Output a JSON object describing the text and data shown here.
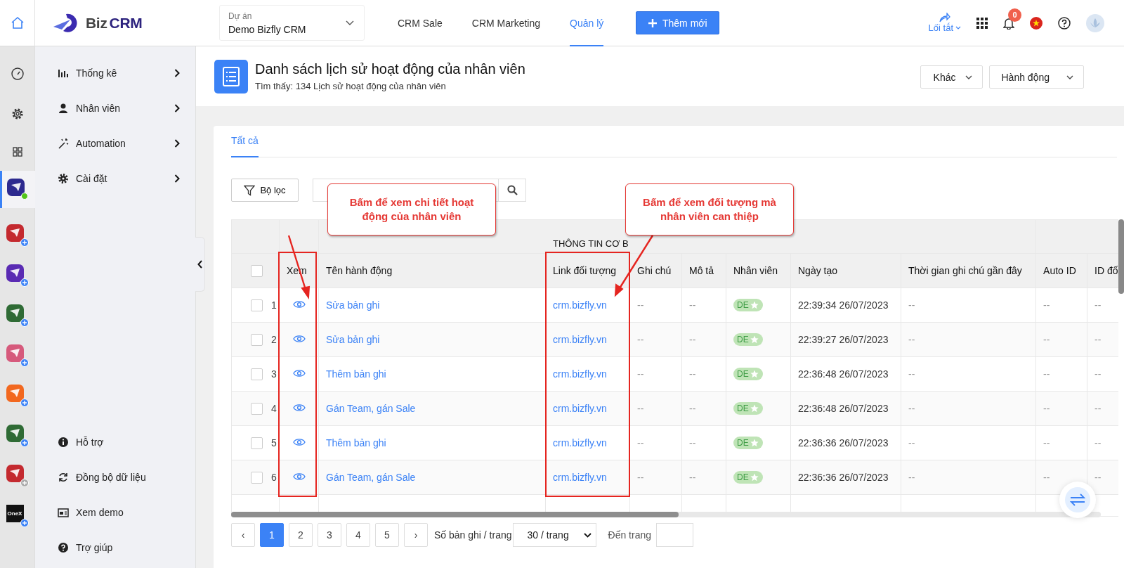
{
  "topbar": {
    "logo": {
      "light": "Biz",
      "bold": "CRM"
    },
    "project": {
      "label": "Dự án",
      "value": "Demo Bizfly CRM"
    },
    "nav": [
      {
        "label": "CRM Sale",
        "selected": false
      },
      {
        "label": "CRM Marketing",
        "selected": false
      },
      {
        "label": "Quản lý",
        "selected": true
      }
    ],
    "add_button": "Thêm mới",
    "shortcut": "Lối tắt",
    "notification_count": "0"
  },
  "rail": [
    {
      "kind": "dashboard",
      "selected": false
    },
    {
      "kind": "settings",
      "selected": false
    },
    {
      "kind": "grid",
      "selected": false
    },
    {
      "kind": "app",
      "color": "#2d2a8f",
      "online": true,
      "plus": false,
      "selected": true
    },
    {
      "kind": "app",
      "color": "#c42a2f",
      "online": false,
      "plus": true,
      "muted": false,
      "selected": false
    },
    {
      "kind": "app",
      "color": "#5a2bb3",
      "online": false,
      "plus": true,
      "muted": false,
      "selected": false
    },
    {
      "kind": "app",
      "color": "#2f6b35",
      "online": false,
      "plus": true,
      "muted": false,
      "selected": false
    },
    {
      "kind": "app",
      "color": "#d65a7c",
      "online": false,
      "plus": true,
      "muted": false,
      "selected": false
    },
    {
      "kind": "app",
      "color": "#f2681f",
      "online": false,
      "plus": true,
      "muted": false,
      "selected": false
    },
    {
      "kind": "app",
      "color": "#2f6b35",
      "online": false,
      "plus": true,
      "muted": false,
      "selected": false
    },
    {
      "kind": "app",
      "color": "#c42a2f",
      "online": false,
      "plus": true,
      "muted": true,
      "selected": false
    },
    {
      "kind": "onex",
      "label": "OneX",
      "color": "#111111",
      "online": false,
      "plus": true,
      "muted": false,
      "selected": false
    }
  ],
  "sidebar": {
    "items": [
      {
        "label": "Thống kê",
        "kind": "chart"
      },
      {
        "label": "Nhân viên",
        "kind": "person"
      },
      {
        "label": "Automation",
        "kind": "wand"
      },
      {
        "label": "Cài đặt",
        "kind": "gear"
      }
    ],
    "footer": [
      {
        "label": "Hỗ trợ",
        "kind": "info"
      },
      {
        "label": "Đồng bộ dữ liệu",
        "kind": "sync"
      },
      {
        "label": "Xem demo",
        "kind": "screen"
      },
      {
        "label": "Trợ giúp",
        "kind": "help"
      }
    ]
  },
  "page": {
    "title": "Danh sách lịch sử hoạt động của nhân viên",
    "subtitle": "Tìm thấy: 134 Lịch sử hoạt động của nhân viên",
    "buttons": [
      "Khác",
      "Hành động"
    ]
  },
  "tabs": [
    {
      "label": "Tất cả",
      "selected": true
    }
  ],
  "filter_button": "Bộ lọc",
  "table": {
    "group_header": "THÔNG TIN CƠ B",
    "select_all_checked": false,
    "columns": [
      "Xem",
      "Tên hành động",
      "Link đối tượng",
      "Ghi chú",
      "Mô tả",
      "Nhân viên",
      "Ngày tạo",
      "Thời gian ghi chú gần đây",
      "Auto ID",
      "ID đố"
    ],
    "rows": [
      {
        "index": "1",
        "checked": false,
        "action": "Sửa bản ghi",
        "link": "crm.bizfly.vn",
        "note": "--",
        "description": "--",
        "staff": "DE",
        "created": "22:39:34 26/07/2023",
        "last_note": "--",
        "auto_id": "--",
        "id": "--"
      },
      {
        "index": "2",
        "checked": false,
        "action": "Sửa bản ghi",
        "link": "crm.bizfly.vn",
        "note": "--",
        "description": "--",
        "staff": "DE",
        "created": "22:39:27 26/07/2023",
        "last_note": "--",
        "auto_id": "--",
        "id": "--"
      },
      {
        "index": "3",
        "checked": false,
        "action": "Thêm bản ghi",
        "link": "crm.bizfly.vn",
        "note": "--",
        "description": "--",
        "staff": "DE",
        "created": "22:36:48 26/07/2023",
        "last_note": "--",
        "auto_id": "--",
        "id": "--"
      },
      {
        "index": "4",
        "checked": false,
        "action": "Gán Team, gán Sale",
        "link": "crm.bizfly.vn",
        "note": "--",
        "description": "--",
        "staff": "DE",
        "created": "22:36:48 26/07/2023",
        "last_note": "--",
        "auto_id": "--",
        "id": "--"
      },
      {
        "index": "5",
        "checked": false,
        "action": "Thêm bản ghi",
        "link": "crm.bizfly.vn",
        "note": "--",
        "description": "--",
        "staff": "DE",
        "created": "22:36:36 26/07/2023",
        "last_note": "--",
        "auto_id": "--",
        "id": "--"
      },
      {
        "index": "6",
        "checked": false,
        "action": "Gán Team, gán Sale",
        "link": "crm.bizfly.vn",
        "note": "--",
        "description": "--",
        "staff": "DE",
        "created": "22:36:36 26/07/2023",
        "last_note": "--",
        "auto_id": "--",
        "id": "--"
      }
    ]
  },
  "callouts": [
    "Bấm để xem chi tiết hoạt động của nhân viên",
    "Bấm để xem đối tượng mà nhân viên can thiệp"
  ],
  "pagination": {
    "prev": "‹",
    "next": "›",
    "pages": [
      {
        "label": "1",
        "selected": true
      },
      {
        "label": "2",
        "selected": false
      },
      {
        "label": "3",
        "selected": false
      },
      {
        "label": "4",
        "selected": false
      },
      {
        "label": "5",
        "selected": false
      }
    ],
    "page_size_label": "Số bản ghi / trang",
    "page_size": "30 / trang",
    "goto_label": "Đến trang"
  }
}
